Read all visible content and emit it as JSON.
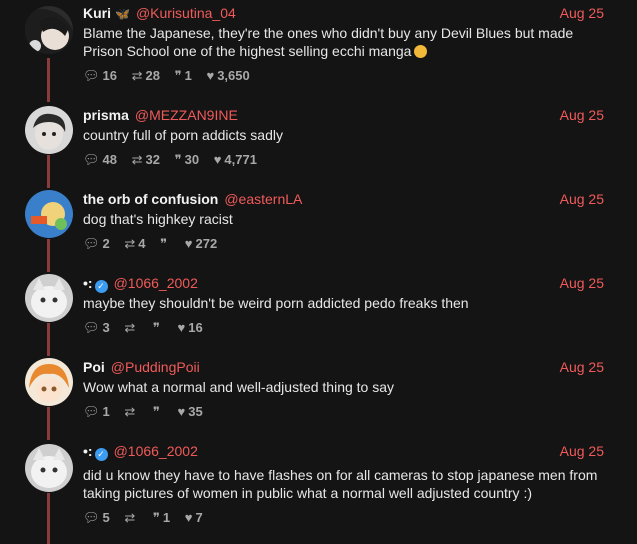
{
  "colors": {
    "accent": "#f05a5a",
    "thread_line": "#8a3c3c",
    "background": "#141414",
    "verified": "#3b9cf0"
  },
  "posts": [
    {
      "name": "Kuri",
      "flair": "🦋",
      "handle": "@Kurisutina_04",
      "date": "Aug 25",
      "text": "Blame the Japanese, they're the ones who didn't buy any Devil Blues but made Prison School one of the highest selling ecchi manga",
      "emoji": "disappointed-face",
      "replies": "16",
      "reposts": "28",
      "quotes": "1",
      "likes": "3,650"
    },
    {
      "name": "prisma",
      "handle": "@MEZZAN9INE",
      "date": "Aug 25",
      "text": "country full of porn addicts sadly",
      "replies": "48",
      "reposts": "32",
      "quotes": "30",
      "likes": "4,771"
    },
    {
      "name": "the orb of confusion",
      "handle": "@easternLA",
      "date": "Aug 25",
      "text": "dog that's highkey racist",
      "replies": "2",
      "reposts": "4",
      "quotes": "",
      "likes": "272"
    },
    {
      "name": "•:",
      "verified": true,
      "handle": "@1066_2002",
      "date": "Aug 25",
      "text": "maybe they shouldn't be weird porn addicted pedo freaks then",
      "replies": "3",
      "reposts": "",
      "quotes": "",
      "likes": "16"
    },
    {
      "name": "Poi",
      "handle": "@PuddingPoii",
      "date": "Aug 25",
      "text": "Wow what a normal and well-adjusted thing to say",
      "replies": "1",
      "reposts": "",
      "quotes": "",
      "likes": "35"
    },
    {
      "name": "•:",
      "verified": true,
      "handle": "@1066_2002",
      "date": "Aug 25",
      "text": "did u know they have to have flashes on for all cameras to stop japanese men from taking pictures of women in public what a normal well adjusted country :)",
      "replies": "5",
      "reposts": "",
      "quotes": "1",
      "likes": "7"
    }
  ],
  "icons": {
    "reply": "speech-bubble-icon",
    "repost": "repost-arrows-icon",
    "quote": "quote-icon",
    "like": "heart-icon",
    "verified": "verified-check-icon"
  }
}
